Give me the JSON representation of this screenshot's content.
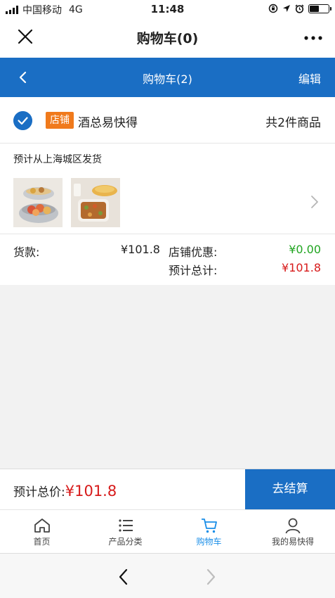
{
  "status_bar": {
    "carrier": "中国移动",
    "network": "4G",
    "time": "11:48"
  },
  "top_bar": {
    "title": "购物车(0)",
    "close_icon": "close-icon",
    "more_icon": "more-icon"
  },
  "header": {
    "title": "购物车(2)",
    "edit_label": "编辑",
    "back_icon": "back-icon"
  },
  "store": {
    "tag": "店铺",
    "name": "酒总易快得",
    "count_text": "共2件商品",
    "shipping_text": "预计从上海城区发货",
    "goods_label": "货款:",
    "goods_value": "¥101.8",
    "discount_label": "店铺优惠:",
    "discount_value": "¥0.00",
    "total_label": "预计总计:",
    "total_value": "¥101.8"
  },
  "checkout": {
    "est_label": "预计总价:",
    "est_amount": "¥101.8",
    "button_label": "去结算"
  },
  "tabs": [
    {
      "label": "首页",
      "icon": "home-icon",
      "active": false
    },
    {
      "label": "产品分类",
      "icon": "list-icon",
      "active": false
    },
    {
      "label": "购物车",
      "icon": "cart-icon",
      "active": true
    },
    {
      "label": "我的易快得",
      "icon": "user-icon",
      "active": false
    }
  ],
  "colors": {
    "primary": "#1a6ec4",
    "store_tag": "#f07a1c",
    "discount": "#21a521",
    "price": "#d71a1a",
    "tab_active": "#1a8ee8"
  }
}
